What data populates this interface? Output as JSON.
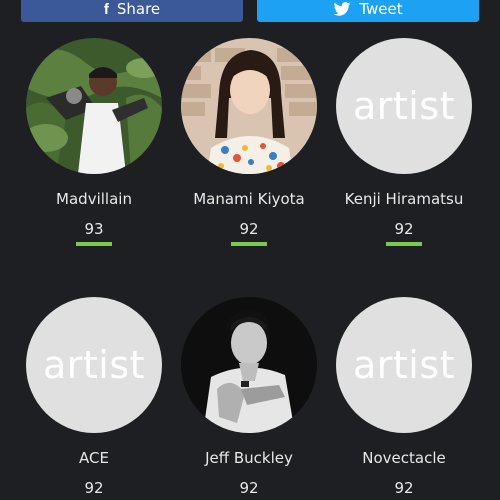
{
  "share": {
    "facebook_label": "Share",
    "twitter_label": "Tweet",
    "facebook_color": "#3b5998",
    "twitter_color": "#1da1f2"
  },
  "artists": [
    {
      "name": "Madvillain",
      "score": "93",
      "image": "photo",
      "progress": 0.93
    },
    {
      "name": "Manami Kiyota",
      "score": "92",
      "image": "photo",
      "progress": 0.92
    },
    {
      "name": "Kenji Hiramatsu",
      "score": "92",
      "image": "placeholder",
      "placeholder_text": "artist",
      "progress": 0.92
    },
    {
      "name": "ACE",
      "score": "92",
      "image": "placeholder",
      "placeholder_text": "artist",
      "progress": 0.92
    },
    {
      "name": "Jeff Buckley",
      "score": "92",
      "image": "photo",
      "progress": 0.92
    },
    {
      "name": "Novectacle",
      "score": "92",
      "image": "placeholder",
      "placeholder_text": "artist",
      "progress": 0.92
    }
  ],
  "colors": {
    "background": "#1e1f22",
    "score_bar": "#7ac94e",
    "placeholder": "#e0e0e0"
  }
}
